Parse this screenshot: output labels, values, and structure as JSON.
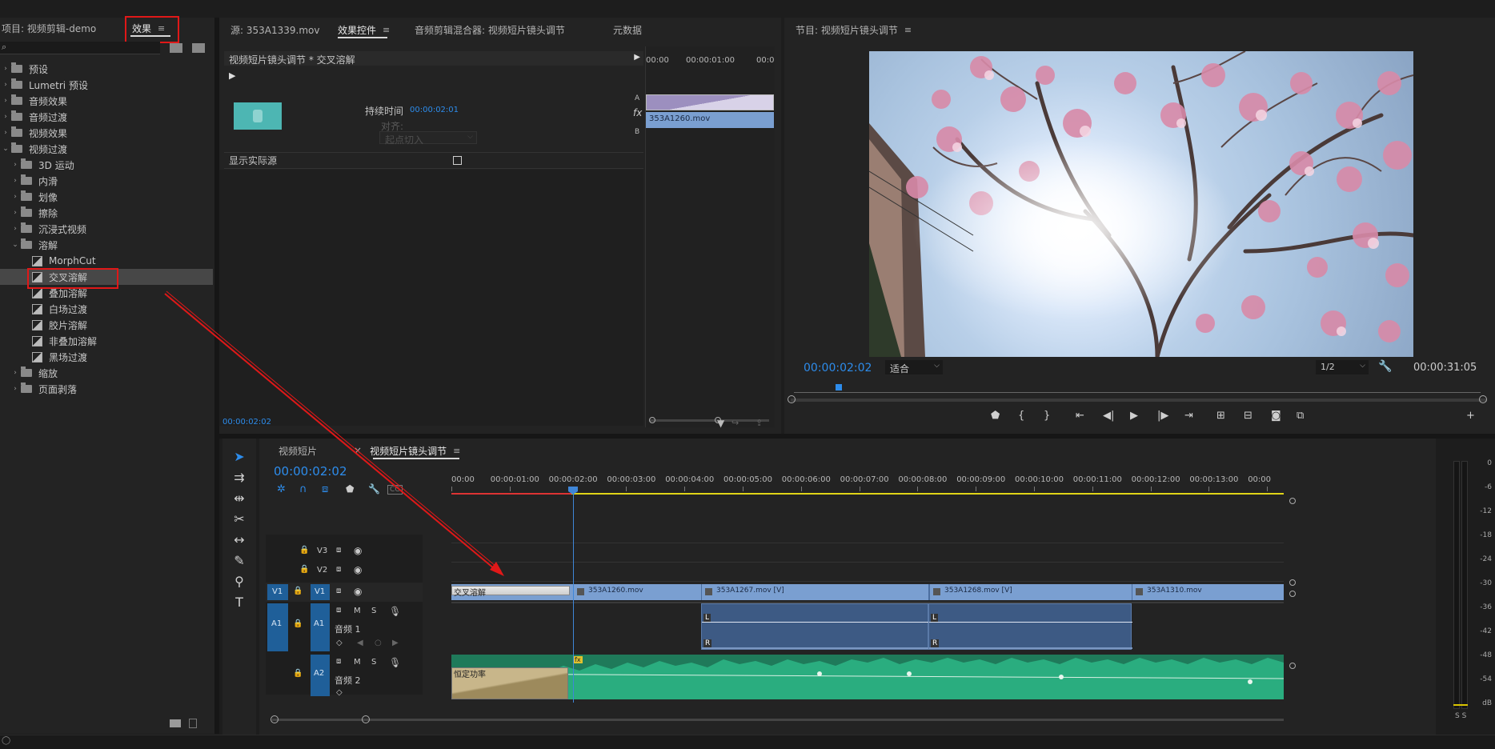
{
  "effects_panel": {
    "project_tab": "项目: 视频剪辑-demo",
    "effects_tab": "效果",
    "menu_glyph": "≡",
    "tree": [
      {
        "label": "预设",
        "kind": "folder"
      },
      {
        "label": "Lumetri 预设",
        "kind": "folder"
      },
      {
        "label": "音频效果",
        "kind": "folder"
      },
      {
        "label": "音频过渡",
        "kind": "folder"
      },
      {
        "label": "视频效果",
        "kind": "folder"
      },
      {
        "label": "视频过渡",
        "kind": "folder-open"
      },
      {
        "label": "3D 运动",
        "kind": "subfolder"
      },
      {
        "label": "内滑",
        "kind": "subfolder"
      },
      {
        "label": "划像",
        "kind": "subfolder"
      },
      {
        "label": "擦除",
        "kind": "subfolder"
      },
      {
        "label": "沉浸式视频",
        "kind": "subfolder"
      },
      {
        "label": "溶解",
        "kind": "subfolder-open"
      },
      {
        "label": "MorphCut",
        "kind": "item"
      },
      {
        "label": "交叉溶解",
        "kind": "item-selected"
      },
      {
        "label": "叠加溶解",
        "kind": "item"
      },
      {
        "label": "白场过渡",
        "kind": "item"
      },
      {
        "label": "胶片溶解",
        "kind": "item"
      },
      {
        "label": "非叠加溶解",
        "kind": "item"
      },
      {
        "label": "黑场过渡",
        "kind": "item"
      },
      {
        "label": "缩放",
        "kind": "subfolder"
      },
      {
        "label": "页面剥落",
        "kind": "subfolder"
      }
    ]
  },
  "source_panel": {
    "source_tab": "源: 353A1339.mov",
    "effect_controls_tab": "效果控件",
    "audio_mixer_tab": "音频剪辑混合器: 视频短片镜头调节",
    "metadata_tab": "元数据",
    "menu_glyph": "≡",
    "breadcrumb": "视频短片镜头调节 * 交叉溶解",
    "duration_label": "持续时间",
    "duration_value": "00:00:02:01",
    "align_label": "对齐:",
    "align_value": "起点切入",
    "show_actual_label": "显示实际源",
    "timecode": "00:00:02:02",
    "mini_ruler": [
      "00:00",
      "00:00:01:00",
      "00:0"
    ],
    "mini_clip": "353A1260.mov",
    "track_a": "A",
    "track_b": "B",
    "fx_label": "fx"
  },
  "program_panel": {
    "title": "节目: 视频短片镜头调节",
    "menu_glyph": "≡",
    "timecode": "00:00:02:02",
    "fit_value": "适合",
    "resolution_value": "1/2",
    "duration": "00:00:31:05"
  },
  "timeline": {
    "tab1": "视频短片",
    "tab2": "视频短片镜头调节",
    "close_glyph": "×",
    "menu_glyph": "≡",
    "timecode": "00:00:02:02",
    "ruler": [
      "00:00",
      "00:00:01:00",
      "00:00:02:00",
      "00:00:03:00",
      "00:00:04:00",
      "00:00:05:00",
      "00:00:06:00",
      "00:00:07:00",
      "00:00:08:00",
      "00:00:09:00",
      "00:00:10:00",
      "00:00:11:00",
      "00:00:12:00",
      "00:00:13:00",
      "00:00"
    ],
    "tracks": {
      "v3": "V3",
      "v2": "V2",
      "v1_src": "V1",
      "v1": "V1",
      "a1_src": "A1",
      "a1": "A1",
      "a2": "A2",
      "audio1_name": "音频 1",
      "audio2_name": "音频 2",
      "m": "M",
      "s": "S"
    },
    "transition_label": "交叉溶解",
    "audio_transition_label": "恒定功率",
    "clips": [
      "353A1260.mov",
      "353A1267.mov [V]",
      "353A1268.mov [V]",
      "353A1310.mov"
    ],
    "l_marker": "L",
    "r_marker": "R",
    "fx_badge": "fx"
  },
  "meter": {
    "labels": [
      "0",
      "-6",
      "-12",
      "-18",
      "-24",
      "-30",
      "-36",
      "-42",
      "-48",
      "-54",
      "dB"
    ],
    "bottom": "S S"
  },
  "colors": {
    "accent_blue": "#2d8ceb",
    "highlight_red": "#e01818",
    "video_clip": "#7a9fd1",
    "audio_clip": "#3d5a84",
    "audio_green": "#1f8f6a",
    "playhead": "#3f86d8"
  }
}
